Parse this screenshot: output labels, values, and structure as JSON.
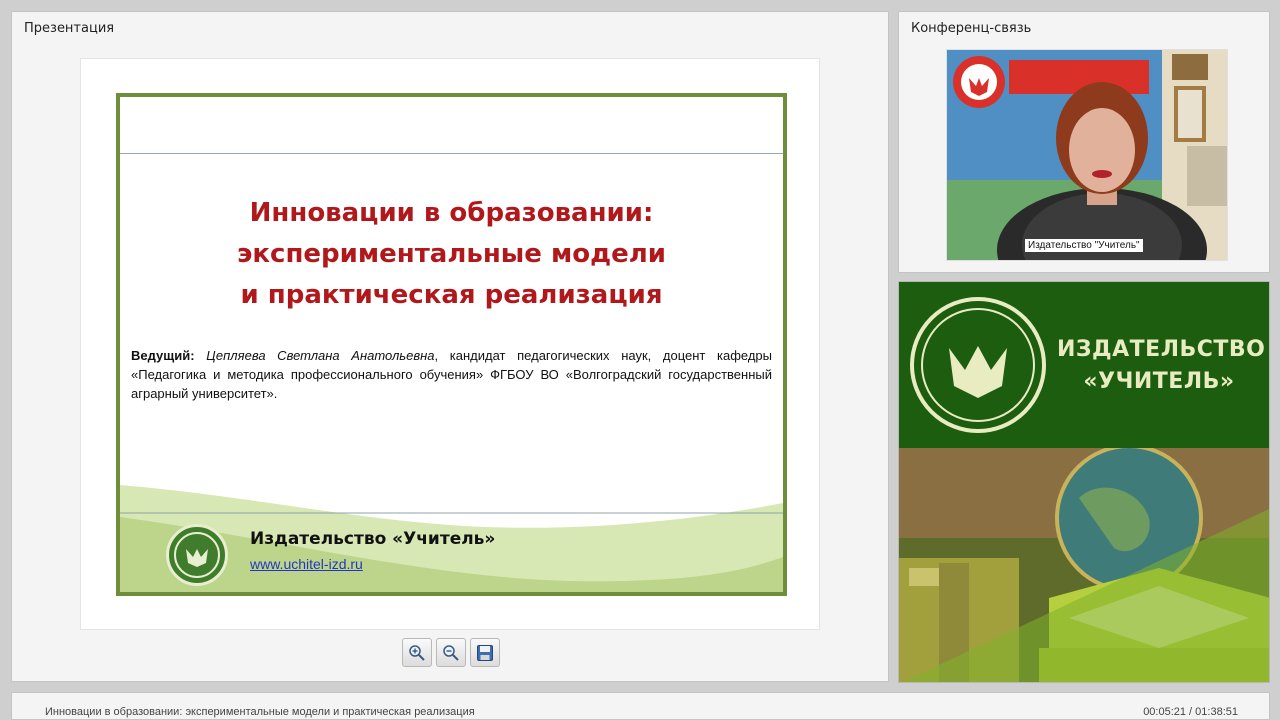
{
  "panels": {
    "presentation_title": "Презентация",
    "conference_title": "Конференц-связь"
  },
  "slide": {
    "title_line1": "Инновации в образовании:",
    "title_line2": "экспериментальные модели",
    "title_line3": "и практическая реализация",
    "host_label": "Ведущий:",
    "host_name": "Цепляева Светлана Анатольевна",
    "host_details": ", кандидат педагогических наук, доцент кафедры «Педагогика и методика профессионального обучения» ФГБОУ ВО «Волгоградский государственный аграрный университет».",
    "publisher": "Издательство «Учитель»",
    "url": "www.uchitel-izd.ru"
  },
  "toolbar": {
    "zoom_in_icon": "zoom-in-icon",
    "zoom_out_icon": "zoom-out-icon",
    "save_icon": "floppy-disk-icon"
  },
  "video": {
    "caption": "Издательство \"Учитель\""
  },
  "banner": {
    "line1": "ИЗДАТЕЛЬСТВО",
    "line2": "«УЧИТЕЛЬ»"
  },
  "status": {
    "title": "Инновации в образовании: экспериментальные модели и практическая реализация",
    "time": "00:05:21 / 01:38:51"
  },
  "colors": {
    "slide_title": "#b0181b",
    "slide_border": "#6f8e3b",
    "banner_green": "#1c5d10",
    "link": "#2235c8"
  }
}
